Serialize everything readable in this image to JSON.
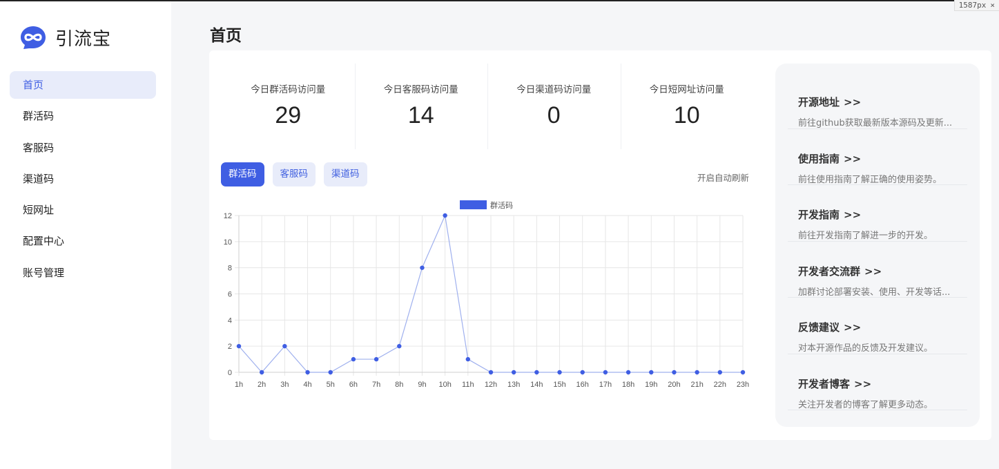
{
  "browser": {
    "width_badge": "1587px",
    "close_glyph": "×"
  },
  "app": {
    "name": "引流宝",
    "logo_icon": "infinity-logo-icon",
    "accent": "#3f5ee3"
  },
  "sidebar": {
    "items": [
      {
        "label": "首页",
        "active": true
      },
      {
        "label": "群活码"
      },
      {
        "label": "客服码"
      },
      {
        "label": "渠道码"
      },
      {
        "label": "短网址"
      },
      {
        "label": "配置中心"
      },
      {
        "label": "账号管理"
      }
    ]
  },
  "page": {
    "title": "首页"
  },
  "stats": [
    {
      "label": "今日群活码访问量",
      "value": "29"
    },
    {
      "label": "今日客服码访问量",
      "value": "14"
    },
    {
      "label": "今日渠道码访问量",
      "value": "0"
    },
    {
      "label": "今日短网址访问量",
      "value": "10"
    }
  ],
  "tabs": [
    {
      "label": "群活码",
      "active": true
    },
    {
      "label": "客服码"
    },
    {
      "label": "渠道码"
    }
  ],
  "auto_refresh": "开启自动刷新",
  "chart_data": {
    "type": "line",
    "categories": [
      "1h",
      "2h",
      "3h",
      "4h",
      "5h",
      "6h",
      "7h",
      "8h",
      "9h",
      "10h",
      "11h",
      "12h",
      "13h",
      "14h",
      "15h",
      "16h",
      "17h",
      "18h",
      "19h",
      "20h",
      "21h",
      "22h",
      "23h"
    ],
    "series": [
      {
        "name": "群活码",
        "values": [
          2,
          0,
          2,
          0,
          0,
          1,
          1,
          2,
          8,
          12,
          1,
          0,
          0,
          0,
          0,
          0,
          0,
          0,
          0,
          0,
          0,
          0,
          0
        ],
        "color": "#3f5ee3"
      }
    ],
    "yticks": [
      "0",
      "2",
      "4",
      "6",
      "8",
      "10",
      "12"
    ],
    "ylim": [
      0,
      12
    ],
    "grid": true,
    "legend": "top-center"
  },
  "links": [
    {
      "title": "开源地址",
      "arrow": ">>",
      "desc": "前往github获取最新版本源码及更新..."
    },
    {
      "title": "使用指南",
      "arrow": ">>",
      "desc": "前往使用指南了解正确的使用姿势。"
    },
    {
      "title": "开发指南",
      "arrow": ">>",
      "desc": "前往开发指南了解进一步的开发。"
    },
    {
      "title": "开发者交流群",
      "arrow": ">>",
      "desc": "加群讨论部署安装、使用、开发等话..."
    },
    {
      "title": "反馈建议",
      "arrow": ">>",
      "desc": "对本开源作品的反馈及开发建议。"
    },
    {
      "title": "开发者博客",
      "arrow": ">>",
      "desc": "关注开发者的博客了解更多动态。"
    }
  ]
}
